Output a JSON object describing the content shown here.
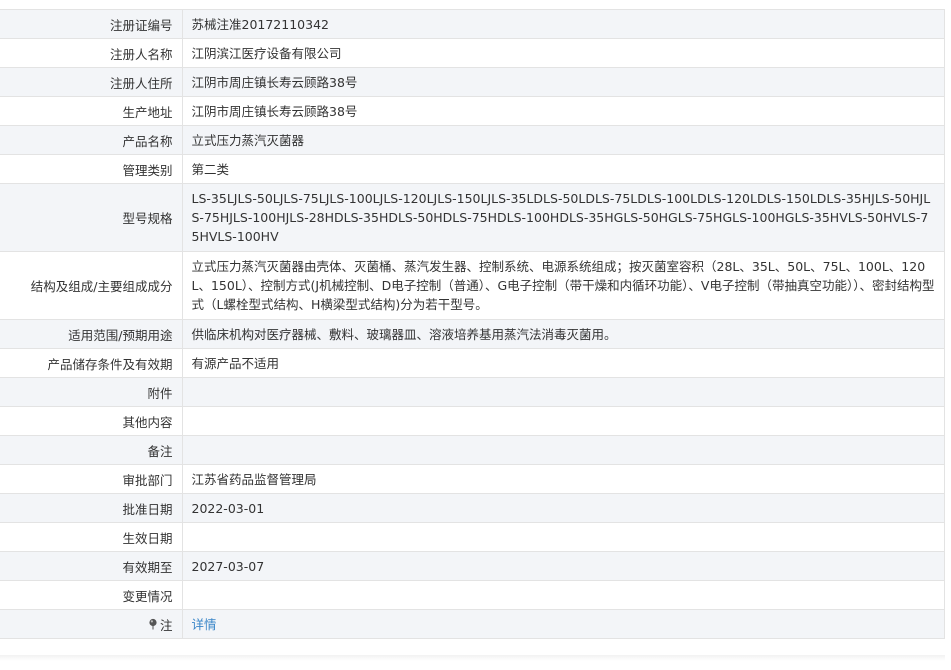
{
  "rows": [
    {
      "label": "注册证编号",
      "value": "苏械注准20172110342"
    },
    {
      "label": "注册人名称",
      "value": "江阴滨江医疗设备有限公司"
    },
    {
      "label": "注册人住所",
      "value": "江阴市周庄镇长寿云顾路38号"
    },
    {
      "label": "生产地址",
      "value": "江阴市周庄镇长寿云顾路38号"
    },
    {
      "label": "产品名称",
      "value": "立式压力蒸汽灭菌器"
    },
    {
      "label": "管理类别",
      "value": "第二类"
    },
    {
      "label": "型号规格",
      "value": "LS-35LJLS-50LJLS-75LJLS-100LJLS-120LJLS-150LJLS-35LDLS-50LDLS-75LDLS-100LDLS-120LDLS-150LDLS-35HJLS-50HJLS-75HJLS-100HJLS-28HDLS-35HDLS-50HDLS-75HDLS-100HDLS-35HGLS-50HGLS-75HGLS-100HGLS-35HVLS-50HVLS-75HVLS-100HV"
    },
    {
      "label": "结构及组成/主要组成成分",
      "value": "立式压力蒸汽灭菌器由壳体、灭菌桶、蒸汽发生器、控制系统、电源系统组成；按灭菌室容积（28L、35L、50L、75L、100L、120L、150L）、控制方式(J机械控制、D电子控制（普通）、G电子控制（带干燥和内循环功能）、V电子控制（带抽真空功能））、密封结构型式（L螺栓型式结构、H横梁型式结构)分为若干型号。"
    },
    {
      "label": "适用范围/预期用途",
      "value": "供临床机构对医疗器械、敷料、玻璃器皿、溶液培养基用蒸汽法消毒灭菌用。"
    },
    {
      "label": "产品储存条件及有效期",
      "value": "有源产品不适用"
    },
    {
      "label": "附件",
      "value": ""
    },
    {
      "label": "其他内容",
      "value": ""
    },
    {
      "label": "备注",
      "value": ""
    },
    {
      "label": "审批部门",
      "value": "江苏省药品监督管理局"
    },
    {
      "label": "批准日期",
      "value": "2022-03-01"
    },
    {
      "label": "生效日期",
      "value": ""
    },
    {
      "label": "有效期至",
      "value": "2027-03-07"
    },
    {
      "label": "变更情况",
      "value": ""
    }
  ],
  "note": {
    "label": "注",
    "link_text": "详情",
    "icon": "pin-icon"
  },
  "colors": {
    "stripe": "#f3f5f8",
    "border": "#e3e3e3",
    "link": "#3a86c8",
    "text": "#333333"
  }
}
